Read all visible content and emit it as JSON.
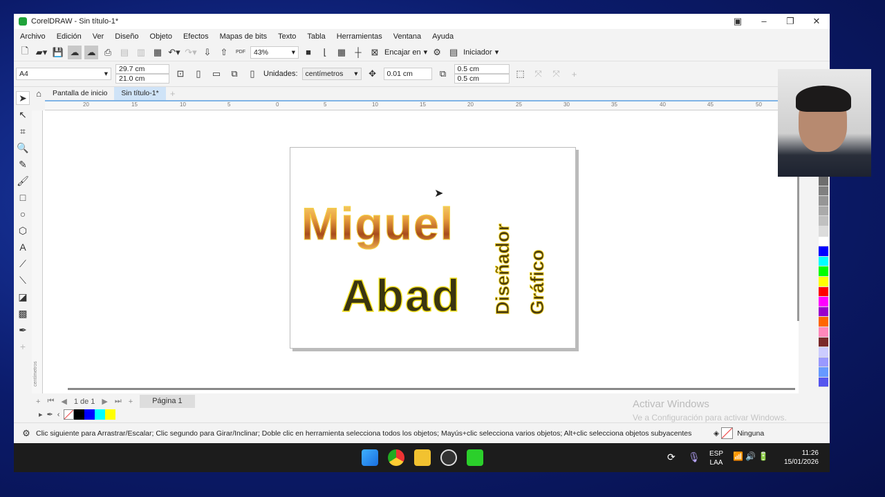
{
  "window": {
    "title": "CorelDRAW - Sin título-1*",
    "controls": [
      "▣",
      "–",
      "❐",
      "✕"
    ]
  },
  "menu": [
    "Archivo",
    "Edición",
    "Ver",
    "Diseño",
    "Objeto",
    "Efectos",
    "Mapas de bits",
    "Texto",
    "Tabla",
    "Herramientas",
    "Ventana",
    "Ayuda"
  ],
  "toolbar": {
    "zoom": "43%",
    "fit_label": "Encajar en",
    "launcher_label": "Iniciador",
    "pdf_label": "PDF"
  },
  "property_bar": {
    "page_size": "A4",
    "width": "29.7 cm",
    "height": "21.0 cm",
    "units_label": "Unidades:",
    "units": "centímetros",
    "nudge": "0.01 cm",
    "dup_x": "0.5 cm",
    "dup_y": "0.5 cm"
  },
  "tabs": {
    "home": "Pantalla de inicio",
    "doc": "Sin título-1*"
  },
  "ruler": {
    "labels": [
      "20",
      "15",
      "10",
      "5",
      "0",
      "5",
      "10",
      "15",
      "20",
      "25",
      "30",
      "35",
      "40",
      "45",
      "50"
    ],
    "vertical_unit": "centímetros"
  },
  "artwork": {
    "line1": "Miguel",
    "line2": "Abad",
    "vertical1": "Diseñador",
    "vertical2": "Gráfico"
  },
  "page_nav": {
    "count": "1 de 1",
    "page_tab": "Página 1"
  },
  "document_palette": [
    "#000000",
    "#0000ff",
    "#00ffff",
    "#ffff00"
  ],
  "color_palette": [
    "#6e6e6e",
    "#808080",
    "#969696",
    "#aaaaaa",
    "#c0c0c0",
    "#dcdcdc",
    "#ffffff",
    "#0000ff",
    "#00ffff",
    "#00ff00",
    "#ffff00",
    "#ff0000",
    "#ff00ff",
    "#9900cc",
    "#ff6600",
    "#ff88bb",
    "#7a2a2a",
    "#ccccff",
    "#9999ff",
    "#6699ff",
    "#5555ee"
  ],
  "watermark": {
    "title": "Activar Windows",
    "subtitle": "Ve a Configuración para activar Windows."
  },
  "status": {
    "hint": "Clic siguiente para Arrastrar/Escalar; Clic segundo para Girar/Inclinar; Doble clic en herramienta selecciona todos los objetos; Mayús+clic selecciona varios objetos; Alt+clic selecciona objetos subyacentes",
    "fill": "Ninguna"
  },
  "taskbar": {
    "lang1": "ESP",
    "lang2": "LAA",
    "time": "11:26",
    "date": "15/01/2026"
  }
}
